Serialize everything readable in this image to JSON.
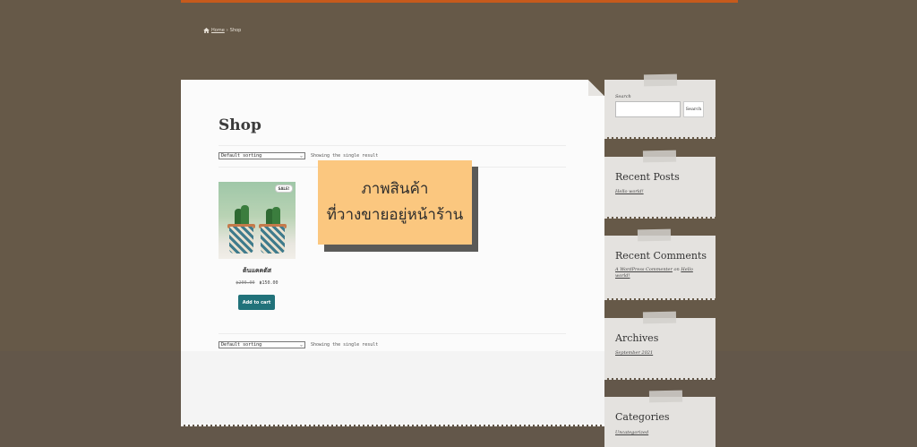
{
  "breadcrumb": {
    "home": "Home",
    "separator": "›",
    "current": "Shop"
  },
  "page": {
    "title": "Shop"
  },
  "toolbar": {
    "sort_selected": "Default sorting",
    "result_count": "Showing the single result"
  },
  "product": {
    "name": "ต้นแคคตัส",
    "sale_badge": "SALE!",
    "price_old": "฿200.00",
    "price_new": "฿150.00",
    "add_to_cart": "Add to cart"
  },
  "callout": {
    "line1": "ภาพสินค้า",
    "line2": "ที่วางขายอยู่หน้าร้าน"
  },
  "sidebar": {
    "search": {
      "label": "Search",
      "button": "Search",
      "value": ""
    },
    "recent_posts": {
      "title": "Recent Posts",
      "items": [
        "Hello world!"
      ]
    },
    "recent_comments": {
      "title": "Recent Comments",
      "author": "A WordPress Commenter",
      "on": "on",
      "post": "Hello world!"
    },
    "archives": {
      "title": "Archives",
      "items": [
        "September 2021"
      ]
    },
    "categories": {
      "title": "Categories",
      "items": [
        "Uncategorized"
      ]
    }
  },
  "colors": {
    "background": "#665948",
    "accent_bar": "#c65a1c",
    "button": "#21727a",
    "callout": "#fbc77f"
  }
}
